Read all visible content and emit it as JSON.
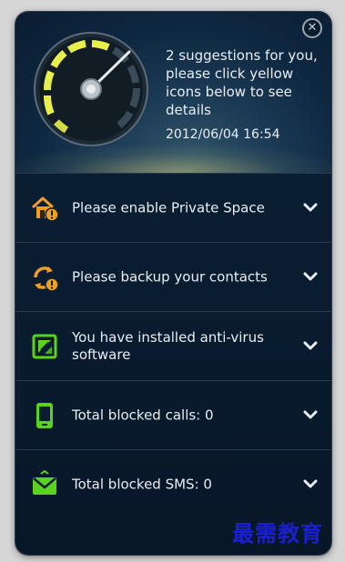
{
  "header": {
    "suggestion_text": "2 suggestions for you, please click yellow icons below to see details",
    "datetime": "2012/06/04 16:54"
  },
  "close_symbol": "✕",
  "items": [
    {
      "label": "Please enable Private Space",
      "icon": "private-space-house-icon",
      "color": "#f0a020"
    },
    {
      "label": "Please backup your contacts",
      "icon": "backup-contacts-icon",
      "color": "#f0a020"
    },
    {
      "label": "You have installed anti-virus software",
      "icon": "anti-virus-shield-icon",
      "color": "#5ad21e"
    },
    {
      "label": "Total blocked calls: 0",
      "icon": "phone-icon",
      "color": "#5ad21e"
    },
    {
      "label": "Total blocked SMS: 0",
      "icon": "envelope-icon",
      "color": "#5ad21e"
    }
  ],
  "watermark": "最需教育"
}
